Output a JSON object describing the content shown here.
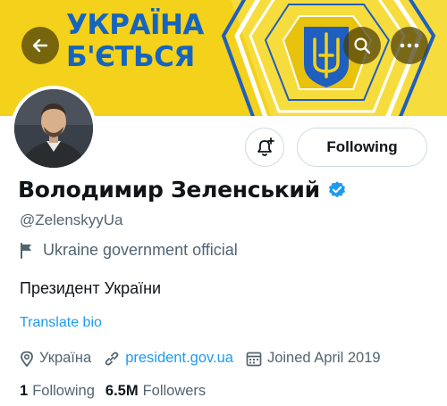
{
  "colors": {
    "banner_bg": "#f4d11a",
    "banner_text": "#1565c0",
    "accent": "#1d9bf0",
    "secondary_text": "#536471",
    "primary_text": "#0f1419"
  },
  "banner": {
    "title_line1": "УКРАЇНА",
    "title_line2": "Б'ЄТЬСЯ",
    "emblem": "trident-emblem"
  },
  "toolbar": {
    "back_icon": "arrow-left-icon",
    "search_icon": "search-icon",
    "more_icon": "more-dots-icon"
  },
  "actions": {
    "notify_icon": "bell-plus-icon",
    "following_label": "Following"
  },
  "profile": {
    "display_name": "Володимир Зеленський",
    "verified": true,
    "handle": "@ZelenskyyUa",
    "affiliation_label": "Ukraine government official",
    "bio": "Президент України",
    "translate_label": "Translate bio",
    "location": "Україна",
    "website": "president.gov.ua",
    "joined": "Joined April 2019"
  },
  "stats": {
    "following_count": "1",
    "following_label": "Following",
    "followers_count": "6.5M",
    "followers_label": "Followers"
  }
}
